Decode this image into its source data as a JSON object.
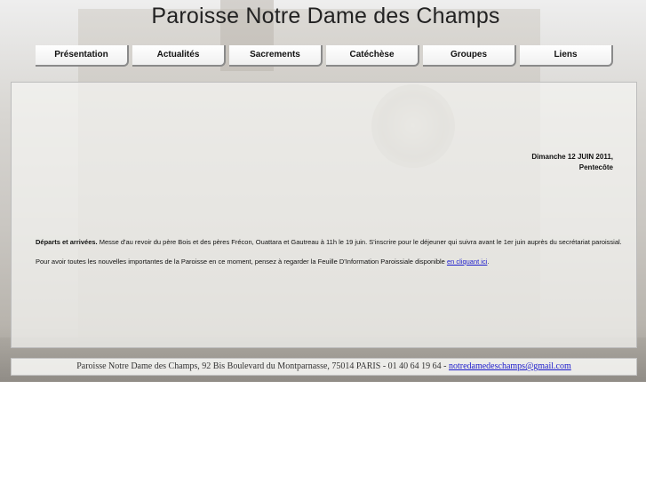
{
  "site_title": "Paroisse Notre Dame des Champs",
  "nav": [
    {
      "label": "Présentation"
    },
    {
      "label": "Actualités"
    },
    {
      "label": "Sacrements"
    },
    {
      "label": "Catéchèse"
    },
    {
      "label": "Groupes"
    },
    {
      "label": "Liens"
    }
  ],
  "date": {
    "line1": "Dimanche 12 JUIN 2011,",
    "line2": "Pentecôte"
  },
  "news": {
    "departures_heading": "Départs et arrivées.",
    "departures_text": " Messe d'au revoir du père Bois et des pères Frécon, Ouattara et Gautreau à 11h le 19 juin. S'inscrire pour le déjeuner qui suivra avant le 1er juin auprès du secrétariat paroissial.",
    "info_text": "Pour avoir toutes les nouvelles importantes de la Paroisse en ce moment, pensez à regarder la Feuille D'Information Paroissiale disponible ",
    "info_link": "en cliquant ici",
    "info_end": "."
  },
  "footer": {
    "address": "Paroisse Notre Dame des Champs, 92 Bis Boulevard du Montparnasse, 75014 PARIS - 01 40 64 19 64 - ",
    "email": "notredamedeschamps@gmail.com"
  }
}
